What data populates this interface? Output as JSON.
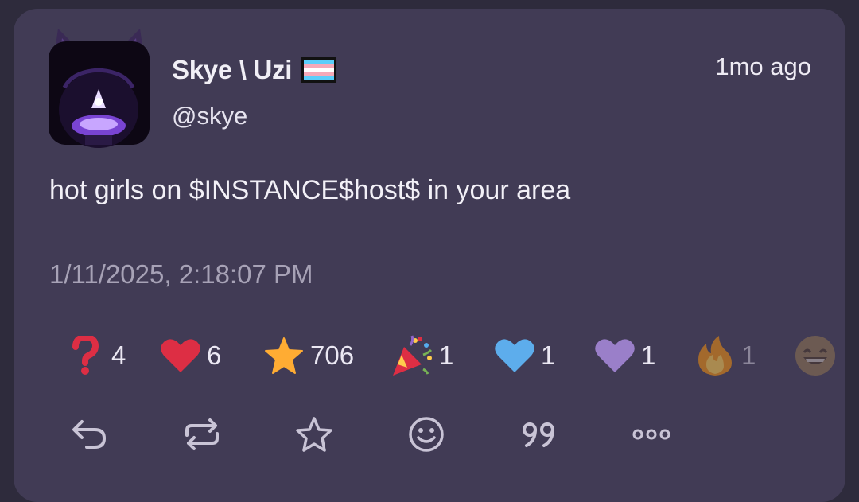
{
  "author": {
    "display_name": "Skye \\ Uzi",
    "handle": "@skye",
    "flag_colors": [
      "#5bcefa",
      "#f5a9b8",
      "#ffffff",
      "#f5a9b8",
      "#5bcefa"
    ]
  },
  "post": {
    "relative_time": "1mo ago",
    "text": "hot girls on $INSTANCE$host$ in your area",
    "timestamp": "1/11/2025, 2:18:07 PM"
  },
  "reactions": [
    {
      "icon": "question-mark-icon",
      "count": "4"
    },
    {
      "icon": "red-heart-icon",
      "count": "6"
    },
    {
      "icon": "star-icon",
      "count": "706"
    },
    {
      "icon": "party-popper-icon",
      "count": "1"
    },
    {
      "icon": "blue-heart-icon",
      "count": "1"
    },
    {
      "icon": "purple-heart-icon",
      "count": "1"
    },
    {
      "icon": "fire-icon",
      "count": "1"
    },
    {
      "icon": "grinning-face-icon",
      "count": ""
    }
  ],
  "actions": [
    "reply-icon",
    "repost-icon",
    "favorite-icon",
    "react-icon",
    "quote-icon",
    "more-icon"
  ],
  "colors": {
    "card_bg": "#413b55",
    "page_bg": "#2e2b3c",
    "text_primary": "#f2f0f7",
    "text_muted": "#a7a2b6",
    "icon": "#c9c4d6"
  }
}
